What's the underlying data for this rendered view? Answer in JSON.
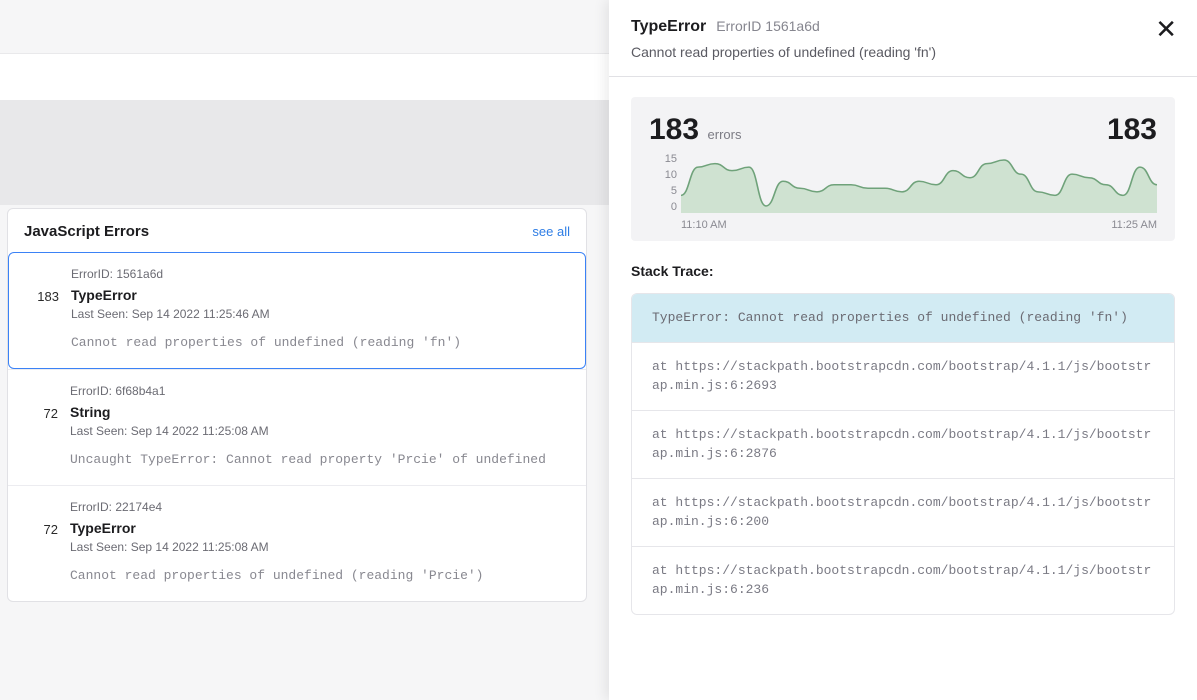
{
  "panel": {
    "title": "JavaScript Errors",
    "see_all": "see all",
    "items": [
      {
        "count": "183",
        "error_id": "ErrorID: 1561a6d",
        "type": "TypeError",
        "last_seen": "Last Seen: Sep 14 2022 11:25:46 AM",
        "message": "Cannot read properties of undefined (reading 'fn')",
        "selected": true
      },
      {
        "count": "72",
        "error_id": "ErrorID: 6f68b4a1",
        "type": "String",
        "last_seen": "Last Seen: Sep 14 2022 11:25:08 AM",
        "message": "Uncaught TypeError: Cannot read property 'Prcie' of undefined",
        "selected": false
      },
      {
        "count": "72",
        "error_id": "ErrorID: 22174e4",
        "type": "TypeError",
        "last_seen": "Last Seen: Sep 14 2022 11:25:08 AM",
        "message": "Cannot read properties of undefined (reading 'Prcie')",
        "selected": false
      }
    ]
  },
  "drawer": {
    "title": "TypeError",
    "subtitle": "ErrorID 1561a6d",
    "message": "Cannot read properties of undefined (reading 'fn')",
    "stack_title": "Stack Trace:",
    "stack": [
      "TypeError: Cannot read properties of undefined (reading 'fn')",
      "    at https://stackpath.bootstrapcdn.com/bootstrap/4.1.1/js/bootstrap.min.js:6:2693",
      "    at https://stackpath.bootstrapcdn.com/bootstrap/4.1.1/js/bootstrap.min.js:6:2876",
      "    at https://stackpath.bootstrapcdn.com/bootstrap/4.1.1/js/bootstrap.min.js:6:200",
      "    at https://stackpath.bootstrapcdn.com/bootstrap/4.1.1/js/bootstrap.min.js:6:236"
    ]
  },
  "chart_data": {
    "type": "area",
    "title": "",
    "total_count": "183",
    "total_label": "errors",
    "right_value": "183",
    "ylabel": "",
    "xlabel": "",
    "ylim": [
      0,
      17
    ],
    "y_ticks": [
      "15",
      "10",
      "5",
      "0"
    ],
    "x_ticks": [
      "11:10 AM",
      "11:25 AM"
    ],
    "series": [
      {
        "name": "errors",
        "color_fill": "#cfe2d1",
        "color_stroke": "#6fa27a",
        "values": [
          5,
          13,
          14,
          12,
          13,
          2,
          9,
          7,
          6,
          8,
          8,
          7,
          7,
          6,
          9,
          8,
          12,
          10,
          14,
          15,
          11,
          6,
          5,
          11,
          10,
          8,
          5,
          13,
          8
        ]
      }
    ]
  }
}
